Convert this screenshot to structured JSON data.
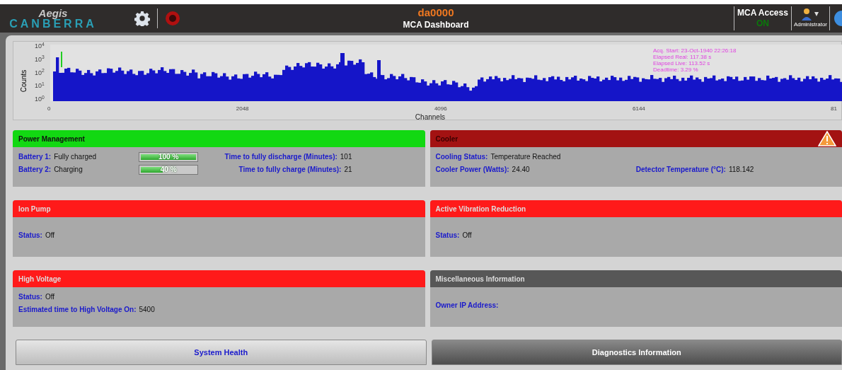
{
  "header": {
    "logo_top": "Aegis",
    "logo_bottom": "CANBERRA",
    "title": "da0000",
    "subtitle": "MCA Dashboard",
    "access_label": "MCA Access",
    "access_state": "ON",
    "user_label": "Administrator"
  },
  "spectrum": {
    "ylabel": "Counts",
    "xlabel": "Channels",
    "yticks": [
      "10$^{4}$",
      "10$^{3}$",
      "10$^{2}$",
      "10$^{1}$",
      "10$^{0}$"
    ],
    "xticks": [
      "0",
      "2048",
      "4096",
      "6144",
      "81"
    ],
    "info": [
      "Acq. Start: 23-Oct-1940 22:26:18",
      "Elapsed Real: 117.38 s",
      "Elapsed Live: 113.52 s",
      "Deadtime: 3.29 %"
    ]
  },
  "panels": [
    {
      "title": "Power Management",
      "color": "#12d812",
      "alert": false,
      "rows": [
        [
          {
            "kind": "battery",
            "label": "Battery 1:",
            "value": "Fully charged",
            "level": 1,
            "reading": "100 %"
          },
          {
            "kind": "field",
            "label": "Time to fully discharge (Minutes):",
            "value": "101"
          }
        ],
        [
          {
            "kind": "battery",
            "label": "Battery 2:",
            "value": "Charging",
            "level": 0.4,
            "reading": "40 %"
          },
          {
            "kind": "field",
            "label": "Time to fully charge (Minutes):",
            "value": "21"
          }
        ]
      ]
    },
    {
      "title": "Cooler",
      "color": "#a31212",
      "alert": true,
      "rows": [
        [
          {
            "kind": "field",
            "label": "Cooling Status:",
            "value": "Temperature Reached"
          }
        ],
        [
          {
            "kind": "field",
            "label": "Cooler Power (Watts):",
            "value": "24.40"
          },
          {
            "kind": "field",
            "label": "Detector Temperature (°C):",
            "value": "118.142"
          }
        ]
      ]
    },
    {
      "title": "Ion Pump",
      "color": "#ff1a1a",
      "alert": false,
      "rows": [
        [
          {
            "kind": "field",
            "label": "Status:",
            "value": "Off"
          }
        ]
      ]
    },
    {
      "title": "Active Vibration Reduction",
      "color": "#ff1a1a",
      "alert": false,
      "rows": [
        [
          {
            "kind": "field",
            "label": "Status:",
            "value": "Off"
          }
        ]
      ]
    },
    {
      "title": "High Voltage",
      "color": "#ff1a1a",
      "alert": false,
      "rows": [
        [
          {
            "kind": "field",
            "label": "Status:",
            "value": "Off"
          }
        ],
        [
          {
            "kind": "field",
            "label": "Estimated time to High Voltage On:",
            "value": "5400"
          }
        ]
      ]
    },
    {
      "title": "Miscellaneous Information",
      "color": "#575757",
      "alert": false,
      "rows": [
        [
          {
            "kind": "field",
            "label": "Owner IP Address:"
          }
        ]
      ]
    }
  ],
  "buttons": [
    {
      "label": "System Health",
      "selected": false
    },
    {
      "label": "Diagnostics Information",
      "selected": true
    }
  ]
}
